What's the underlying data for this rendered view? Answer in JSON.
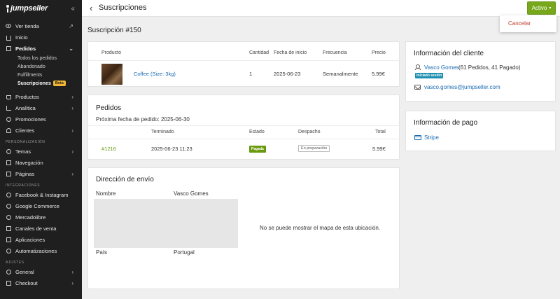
{
  "sidebar": {
    "logo": "jumpseller",
    "items": [
      {
        "label": "Ver tienda"
      },
      {
        "label": "Inicio"
      },
      {
        "label": "Pedidos"
      },
      {
        "label": "Productos"
      },
      {
        "label": "Analítica"
      },
      {
        "label": "Promociones"
      },
      {
        "label": "Clientes"
      }
    ],
    "pedidos_sub": [
      {
        "label": "Todos los pedidos"
      },
      {
        "label": "Abandonado"
      },
      {
        "label": "Fulfillments"
      },
      {
        "label": "Suscripciones"
      }
    ],
    "beta_badge": "Beta",
    "section_personalizacion": "PERSONALIZACIÓN",
    "personalizacion": [
      {
        "label": "Temas"
      },
      {
        "label": "Navegación"
      },
      {
        "label": "Páginas"
      }
    ],
    "section_integraciones": "INTEGRACIONES",
    "integraciones": [
      {
        "label": "Facebook & Instagram"
      },
      {
        "label": "Google Commerce"
      },
      {
        "label": "Mercadolibre"
      },
      {
        "label": "Canales de venta"
      },
      {
        "label": "Aplicaciones"
      },
      {
        "label": "Automatizaciones"
      }
    ],
    "section_ajustes": "AJUSTES",
    "ajustes": [
      {
        "label": "General"
      },
      {
        "label": "Checkout"
      }
    ]
  },
  "header": {
    "title": "Suscripciones",
    "status_button": "Activo",
    "dropdown_cancel": "Cancelar"
  },
  "page_title": "Suscripción #150",
  "product_table": {
    "headers": {
      "product": "Producto",
      "quantity": "Cantidad",
      "start_date": "Fecha de inicio",
      "frequency": "Frecuencia",
      "price": "Precio"
    },
    "row": {
      "product": "Coffee (Size: 3kg)",
      "quantity": "1",
      "start_date": "2025-06-23",
      "frequency": "Semanalmente",
      "price": "5.99€"
    }
  },
  "orders": {
    "title": "Pedidos",
    "next_date": "Próxima fecha de pedido: 2025-06-30",
    "headers": {
      "finished": "Terminado",
      "status": "Estado",
      "dispatch": "Despacho",
      "total": "Total"
    },
    "row": {
      "id": "#1216",
      "finished": "2025-06-23 11:23",
      "status": "Pagada",
      "dispatch": "En preparación",
      "total": "5.99€"
    }
  },
  "shipping": {
    "title": "Dirección de envío",
    "name_label": "Nombre",
    "name_value": "Vasco Gomes",
    "country_label": "País",
    "country_value": "Portugal",
    "map_message": "No se puede mostrar el mapa de esta ubicación."
  },
  "customer": {
    "title": "Información del cliente",
    "name": "Vasco Gomes",
    "stats": "(61 Pedidos, 41 Pagado)",
    "session_badge": "Iniciado sesión",
    "email": "vasco.gomes@jumpseller.com"
  },
  "payment": {
    "title": "Información de pago",
    "method": "Stripe"
  },
  "colors": {
    "sidebar_bg": "#1f1f1f",
    "primary_green": "#77a81c",
    "link_blue": "#1a6bb5",
    "danger_red": "#c0392b",
    "session_teal": "#1d8fb0"
  }
}
